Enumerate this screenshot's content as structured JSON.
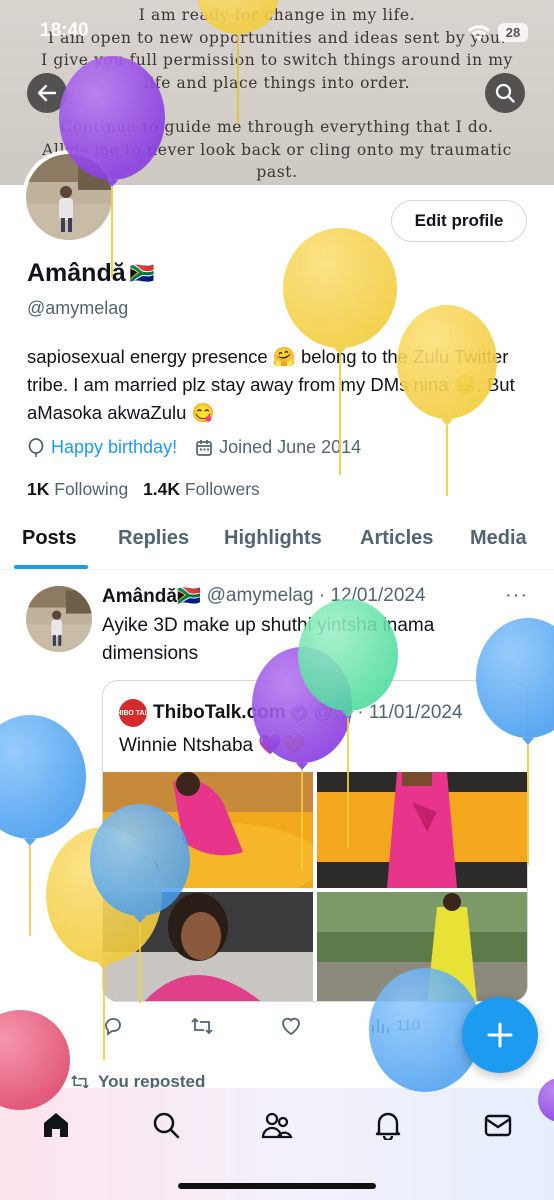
{
  "status_bar": {
    "time": "18:40",
    "battery": "28"
  },
  "banner": {
    "lines": [
      "I am ready for change in my life.",
      "I am open to new opportunities and ideas sent by you.",
      "I give you full permission to switch things around in my",
      "life and place things into order.",
      "",
      "Continue to guide me through everything that I do.",
      "Allow me to never look back or cling onto my traumatic",
      "past."
    ]
  },
  "profile": {
    "edit_label": "Edit profile",
    "name": "Amândă",
    "flag": "🇿🇦",
    "handle": "@amymelag",
    "bio": "sapiosexual energy presence 🤗 belong to the Zulu Twitter tribe. I am married plz stay away from my DMs nina 😔. But aMasoka akwaZulu 😋",
    "birthday": "Happy birthday!",
    "joined": "Joined June 2014",
    "following_count": "1K",
    "following_label": "Following",
    "followers_count": "1.4K",
    "followers_label": "Followers"
  },
  "tabs": [
    "Posts",
    "Replies",
    "Highlights",
    "Articles",
    "Media"
  ],
  "post": {
    "name": "Amândă🇿🇦",
    "handle": "@amymelag · 12/01/2024",
    "more": "···",
    "text": "Ayike 3D make up shuthi yintsha inama dimensions",
    "quote": {
      "logo_text": "THIBO TALK",
      "name": "ThiboTalk.com",
      "date": "@… · 11/01/2024",
      "text": "Winnie Ntshaba 💜💛"
    },
    "views": "110"
  },
  "reposted_label": "You reposted",
  "colors": {
    "accent": "#1d9bf0",
    "muted": "#536471",
    "text": "#0f1419"
  }
}
